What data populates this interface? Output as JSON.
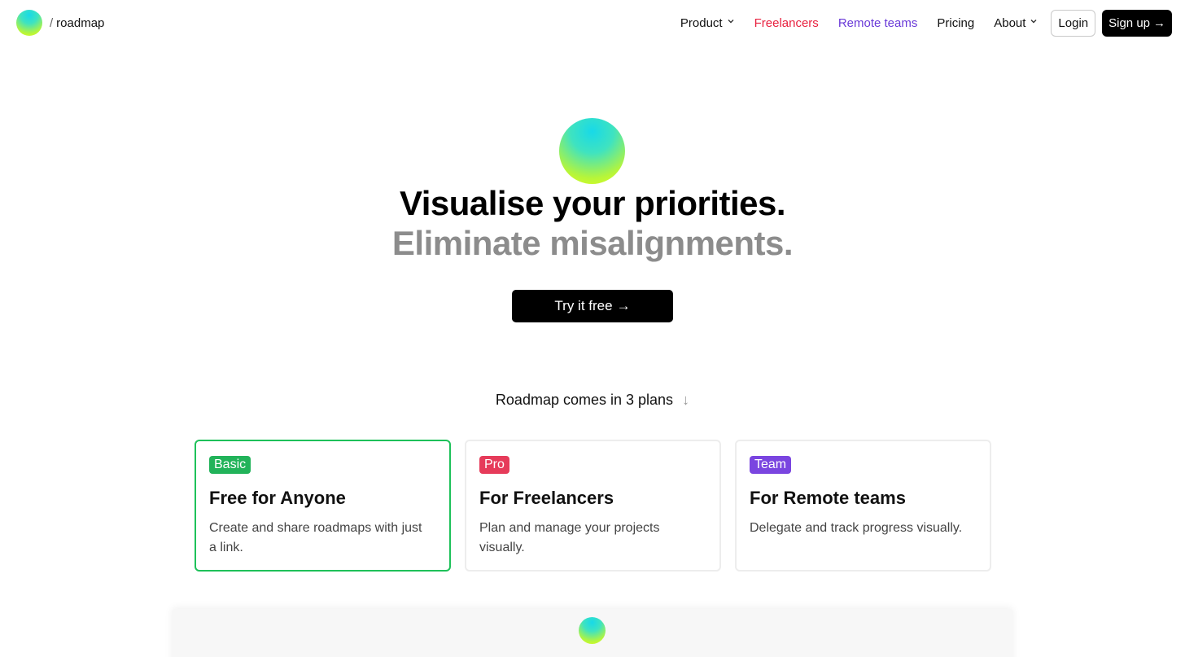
{
  "brand": {
    "slash": "/",
    "name": "roadmap"
  },
  "nav": {
    "items": [
      {
        "label": "Product",
        "chevron": true,
        "color": "#111111"
      },
      {
        "label": "Freelancers",
        "chevron": false,
        "color": "#e8213f"
      },
      {
        "label": "Remote teams",
        "chevron": false,
        "color": "#6a3ad8"
      },
      {
        "label": "Pricing",
        "chevron": false,
        "color": "#111111"
      },
      {
        "label": "About",
        "chevron": true,
        "color": "#111111"
      }
    ],
    "login": "Login",
    "signup": "Sign up",
    "signup_arrow": "→"
  },
  "hero": {
    "line1": "Visualise your priorities.",
    "line2": "Eliminate misalignments.",
    "cta": "Try it free",
    "cta_arrow": "→"
  },
  "plans": {
    "title": "Roadmap comes in 3 plans",
    "arrow": "↓",
    "cards": [
      {
        "badge": "Basic",
        "badge_color": "#22b35a",
        "title": "Free for Anyone",
        "desc": "Create and share roadmaps with just a link.",
        "selected": true
      },
      {
        "badge": "Pro",
        "badge_color": "#e63b5a",
        "title": "For Freelancers",
        "desc": "Plan and manage your projects visually.",
        "selected": false
      },
      {
        "badge": "Team",
        "badge_color": "#7a45e0",
        "title": "For Remote teams",
        "desc": "Delegate and track progress visually.",
        "selected": false
      }
    ]
  },
  "colors": {
    "orb_top": "#18d9e8",
    "orb_bottom": "#e2ff1c",
    "selected_border": "#1ec15a"
  }
}
